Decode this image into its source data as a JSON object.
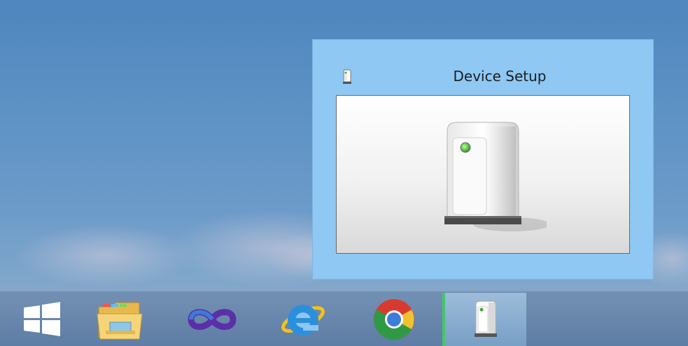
{
  "window_preview": {
    "title": "Device Setup",
    "icon": "device-setup-icon",
    "preview_image": "external-drive-icon"
  },
  "taskbar": {
    "items": [
      {
        "icon": "windows-start-icon"
      },
      {
        "icon": "file-explorer-icon"
      },
      {
        "icon": "visual-studio-icon"
      },
      {
        "icon": "internet-explorer-icon"
      },
      {
        "icon": "chrome-icon"
      },
      {
        "icon": "device-setup-icon",
        "active": true
      }
    ]
  },
  "colors": {
    "thumbnail_bg": "#8ec8f3",
    "active_indicator": "#44c768"
  }
}
